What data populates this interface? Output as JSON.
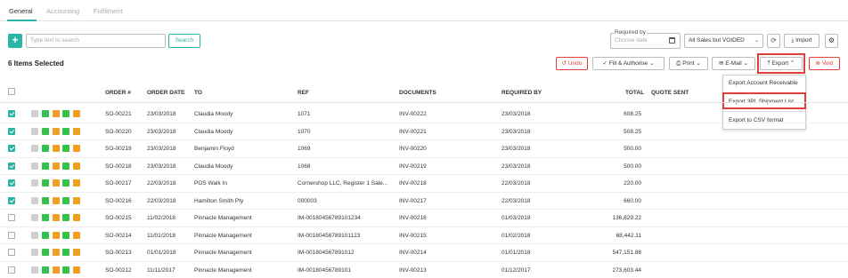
{
  "tabs": [
    {
      "label": "General",
      "active": true
    },
    {
      "label": "Accounting",
      "active": false
    },
    {
      "label": "Fulfilment",
      "active": false
    }
  ],
  "toolbar": {
    "add_label": "+",
    "search_placeholder": "Type text to search",
    "search_button": "Search",
    "required_by_label": "Required by",
    "required_by_placeholder": "Choose date",
    "filter_value": "All Sales but VOIDED",
    "import_label": "Import"
  },
  "selection": {
    "count_text": "6 Items Selected"
  },
  "actions": {
    "undo": "Undo",
    "fill_authorise": "Fill & Authorise",
    "print": "Print",
    "email": "E-Mail",
    "export": "Export",
    "void": "Void"
  },
  "export_menu": [
    "Export Account Receivable",
    "Export 3PL Shipment List",
    "Export to CSV format"
  ],
  "columns": [
    "ORDER #",
    "ORDER DATE",
    "TO",
    "REF",
    "DOCUMENTS",
    "REQUIRED BY",
    "TOTAL",
    "QUOTE SENT"
  ],
  "rows": [
    {
      "checked": true,
      "order": "SO-00221",
      "date": "23/03/2018",
      "to": "Claudia Moody",
      "ref": "1071",
      "doc": "INV-00222",
      "req": "23/03/2018",
      "total": "608.25"
    },
    {
      "checked": true,
      "order": "SO-00220",
      "date": "23/03/2018",
      "to": "Claudia Moody",
      "ref": "1070",
      "doc": "INV-00221",
      "req": "23/03/2018",
      "total": "508.25"
    },
    {
      "checked": true,
      "order": "SO-00219",
      "date": "23/03/2018",
      "to": "Benjamin Floyd",
      "ref": "1069",
      "doc": "INV-00220",
      "req": "23/03/2018",
      "total": "500.00"
    },
    {
      "checked": true,
      "order": "SO-00218",
      "date": "23/03/2018",
      "to": "Claudia Moody",
      "ref": "1068",
      "doc": "INV-00219",
      "req": "23/03/2018",
      "total": "500.00"
    },
    {
      "checked": true,
      "order": "SO-00217",
      "date": "22/03/2018",
      "to": "POS Walk In",
      "ref": "Cornershop LLC, Register 1 Sale...",
      "doc": "INV-00218",
      "req": "22/03/2018",
      "total": "220.00"
    },
    {
      "checked": true,
      "order": "SO-00216",
      "date": "22/03/2018",
      "to": "Hamilton Smith Pty",
      "ref": "000003",
      "doc": "INV-00217",
      "req": "22/03/2018",
      "total": "660.00"
    },
    {
      "checked": false,
      "order": "SO-00215",
      "date": "11/02/2018",
      "to": "Pinnacle Management",
      "ref": "IM-00180456789101234",
      "doc": "INV-00216",
      "req": "01/03/2018",
      "total": "136,829.22"
    },
    {
      "checked": false,
      "order": "SO-00214",
      "date": "11/01/2018",
      "to": "Pinnacle Management",
      "ref": "IM-00180456789101123",
      "doc": "INV-00215",
      "req": "01/02/2018",
      "total": "68,442.11"
    },
    {
      "checked": false,
      "order": "SO-00213",
      "date": "01/01/2018",
      "to": "Pinnacle Management",
      "ref": "IM-001804567891012",
      "doc": "INV-00214",
      "req": "01/01/2018",
      "total": "547,151.88"
    },
    {
      "checked": false,
      "order": "SO-00212",
      "date": "11/11/2017",
      "to": "Pinnacle Management",
      "ref": "IM-00180456789101",
      "doc": "INV-00213",
      "req": "01/12/2017",
      "total": "273,603.44"
    }
  ],
  "status_icons": [
    {
      "name": "quote-icon",
      "color": "#cfcfcf"
    },
    {
      "name": "cart-icon",
      "color": "#36c24a"
    },
    {
      "name": "truck-icon",
      "color": "#f0a020"
    },
    {
      "name": "invoice-icon",
      "color": "#36c24a"
    },
    {
      "name": "card-icon",
      "color": "#f0a020"
    }
  ]
}
